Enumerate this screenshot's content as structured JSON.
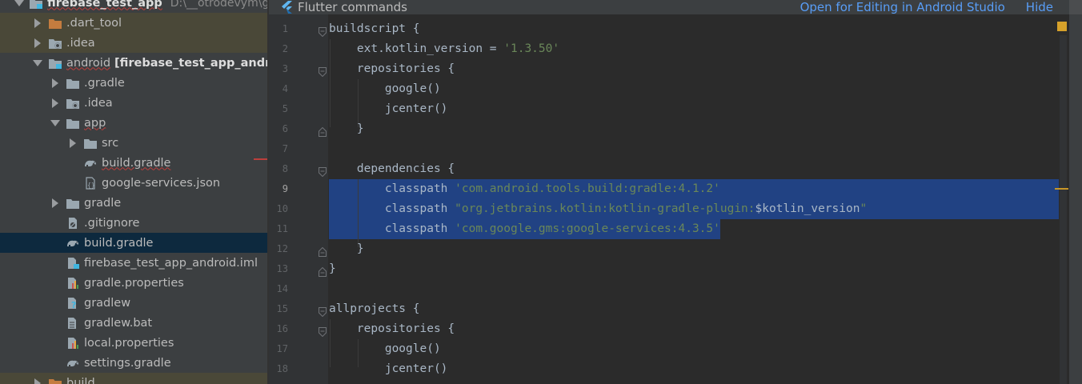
{
  "project_tree": {
    "items": [
      {
        "label": "firebase_test_app",
        "path": "D:\\__otrodevym\\git\\fir",
        "indent": 0,
        "arrow": "down",
        "icon": "folder-module",
        "bold": true,
        "underline": true
      },
      {
        "label": ".dart_tool",
        "indent": 1,
        "arrow": "right",
        "icon": "folder-orange",
        "dim": true
      },
      {
        "label": ".idea",
        "indent": 1,
        "arrow": "right",
        "icon": "folder-gear",
        "dim": true
      },
      {
        "label": "android",
        "module": "[firebase_test_app_android]",
        "indent": 1,
        "arrow": "down",
        "icon": "folder-module",
        "underline": true
      },
      {
        "label": ".gradle",
        "indent": 2,
        "arrow": "right",
        "icon": "folder"
      },
      {
        "label": ".idea",
        "indent": 2,
        "arrow": "right",
        "icon": "folder-gear"
      },
      {
        "label": "app",
        "indent": 2,
        "arrow": "down",
        "icon": "folder",
        "underline": true
      },
      {
        "label": "src",
        "indent": 3,
        "arrow": "right",
        "icon": "folder"
      },
      {
        "label": "build.gradle",
        "indent": 3,
        "arrow": "none",
        "icon": "gradle",
        "underline": true
      },
      {
        "label": "google-services.json",
        "indent": 3,
        "arrow": "none",
        "icon": "json"
      },
      {
        "label": "gradle",
        "indent": 2,
        "arrow": "right",
        "icon": "folder"
      },
      {
        "label": ".gitignore",
        "indent": 2,
        "arrow": "none",
        "icon": "file-ignore"
      },
      {
        "label": "build.gradle",
        "indent": 2,
        "arrow": "none",
        "icon": "gradle",
        "selected": true
      },
      {
        "label": "firebase_test_app_android.iml",
        "indent": 2,
        "arrow": "none",
        "icon": "iml"
      },
      {
        "label": "gradle.properties",
        "indent": 2,
        "arrow": "none",
        "icon": "properties"
      },
      {
        "label": "gradlew",
        "indent": 2,
        "arrow": "none",
        "icon": "file-unknown"
      },
      {
        "label": "gradlew.bat",
        "indent": 2,
        "arrow": "none",
        "icon": "file-text"
      },
      {
        "label": "local.properties",
        "indent": 2,
        "arrow": "none",
        "icon": "properties"
      },
      {
        "label": "settings.gradle",
        "indent": 2,
        "arrow": "none",
        "icon": "gradle"
      },
      {
        "label": "build",
        "indent": 1,
        "arrow": "right",
        "icon": "folder-orange",
        "dim": true
      }
    ]
  },
  "editor": {
    "banner": {
      "title": "Flutter commands",
      "open_link": "Open for Editing in Android Studio",
      "hide_link": "Hide"
    },
    "current_line": 9,
    "selected_lines": [
      9,
      10,
      11
    ],
    "lines": [
      {
        "n": "1",
        "fold": "start",
        "segments": [
          {
            "t": "buildscript {",
            "c": "plain"
          }
        ]
      },
      {
        "n": "2",
        "segments": [
          {
            "t": "    ext.kotlin_version = ",
            "c": "plain"
          },
          {
            "t": "'1.3.50'",
            "c": "str"
          }
        ]
      },
      {
        "n": "3",
        "fold": "start",
        "segments": [
          {
            "t": "    repositories {",
            "c": "plain"
          }
        ]
      },
      {
        "n": "4",
        "segments": [
          {
            "t": "        google()",
            "c": "plain"
          }
        ]
      },
      {
        "n": "5",
        "segments": [
          {
            "t": "        jcenter()",
            "c": "plain"
          }
        ]
      },
      {
        "n": "6",
        "fold": "end",
        "segments": [
          {
            "t": "    }",
            "c": "plain"
          }
        ]
      },
      {
        "n": "7",
        "segments": []
      },
      {
        "n": "8",
        "fold": "start",
        "segments": [
          {
            "t": "    dependencies {",
            "c": "plain"
          }
        ]
      },
      {
        "n": "9",
        "segments": [
          {
            "t": "        classpath ",
            "c": "plain"
          },
          {
            "t": "'com.android.tools.build:gradle:4.1.2'",
            "c": "str"
          }
        ]
      },
      {
        "n": "10",
        "segments": [
          {
            "t": "        classpath ",
            "c": "plain"
          },
          {
            "t": "\"org.jetbrains.kotlin:kotlin-gradle-plugin:",
            "c": "str"
          },
          {
            "t": "$kotlin_version",
            "c": "var"
          },
          {
            "t": "\"",
            "c": "str"
          }
        ]
      },
      {
        "n": "11",
        "segments": [
          {
            "t": "        classpath ",
            "c": "plain"
          },
          {
            "t": "'com.google.gms:google-services:4.3.5'",
            "c": "str"
          }
        ]
      },
      {
        "n": "12",
        "fold": "end",
        "segments": [
          {
            "t": "    }",
            "c": "plain"
          }
        ]
      },
      {
        "n": "13",
        "fold": "end",
        "segments": [
          {
            "t": "}",
            "c": "plain"
          }
        ]
      },
      {
        "n": "14",
        "segments": []
      },
      {
        "n": "15",
        "fold": "start",
        "segments": [
          {
            "t": "allprojects {",
            "c": "plain"
          }
        ]
      },
      {
        "n": "16",
        "fold": "start",
        "segments": [
          {
            "t": "    repositories {",
            "c": "plain"
          }
        ]
      },
      {
        "n": "17",
        "segments": [
          {
            "t": "        google()",
            "c": "plain"
          }
        ]
      },
      {
        "n": "18",
        "segments": [
          {
            "t": "        jcenter()",
            "c": "plain"
          }
        ]
      }
    ]
  },
  "colors": {
    "tree_bg": "#3c3f41",
    "editor_bg": "#2b2b2b",
    "selection": "#214283",
    "string": "#6a8759",
    "keyword_plain": "#a9b7c6",
    "link": "#589df6",
    "folder": "#9aa7b0",
    "folder_orange": "#c47c3f",
    "module_dot": "#40b6e0"
  }
}
